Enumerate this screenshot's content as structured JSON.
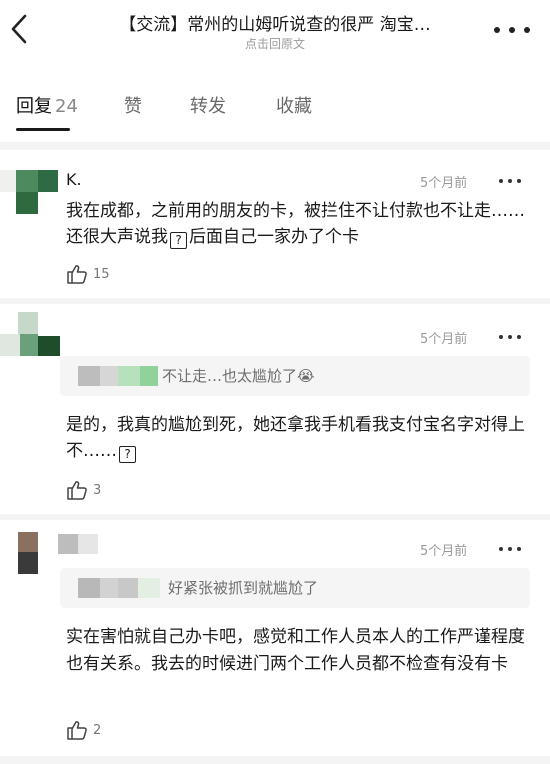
{
  "header": {
    "title": "【交流】常州的山姆听说查的很严 淘宝…",
    "subtitle": "点击回原文",
    "back_icon": "chevron-left-icon",
    "more_icon": "more-dots-icon"
  },
  "tabs": [
    {
      "label": "回复",
      "count": "24"
    },
    {
      "label": "赞"
    },
    {
      "label": "转发"
    },
    {
      "label": "收藏"
    }
  ],
  "comments": [
    {
      "username": "K.",
      "time": "5个月前",
      "text_parts": [
        "我在成都，之前用的朋友的卡，被拦住不让付款也不让走……还很大声说我",
        "后面自己一家办了个卡"
      ],
      "likes": "15"
    },
    {
      "time": "5个月前",
      "quote": "不让走…也太尴尬了😭",
      "text_parts": [
        "是的，我真的尴尬到死，她还拿我手机看我支付宝名字对得上不……"
      ],
      "likes": "3"
    },
    {
      "time": "5个月前",
      "quote": "好紧张被抓到就尴尬了",
      "text": "实在害怕就自己办卡吧，感觉和工作人员本人的工作严谨程度也有关系。我去的时候进门两个工作人员都不检查有没有卡",
      "likes": "2"
    }
  ],
  "glyphs": {
    "unknown": "?"
  },
  "colors": {
    "text": "#1a1a1a",
    "muted": "#9a9a9a",
    "quote_bg": "#f5f5f5"
  }
}
